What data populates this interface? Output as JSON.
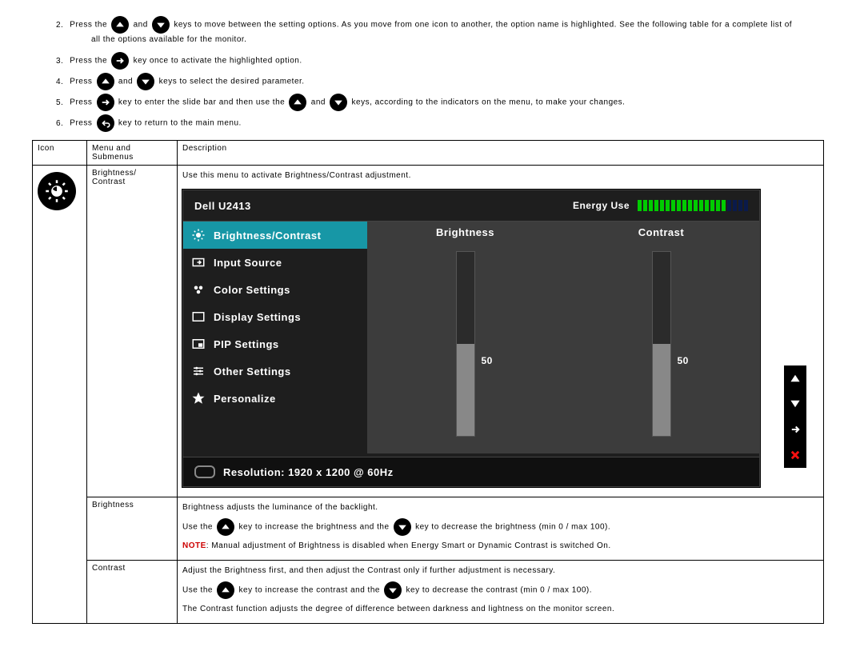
{
  "instructions": {
    "i2a": "Press the",
    "i2b": "and",
    "i2c": "keys to move between the setting options. As you move from one icon to another, the option name is highlighted. See the following table for a complete list of",
    "i2d": "all the options available for the monitor.",
    "i3a": "Press the",
    "i3b": "key once to activate the highlighted option.",
    "i4a": "Press",
    "i4b": "and",
    "i4c": "keys to select the desired parameter.",
    "i5a": "Press",
    "i5b": "key to enter the slide bar and then use the",
    "i5c": "and",
    "i5d": "keys, according to the indicators on the menu, to make your changes.",
    "i6a": "Press",
    "i6b": "key to return to the main menu."
  },
  "table": {
    "head": {
      "icon": "Icon",
      "menu": "Menu and Submenus",
      "desc": "Description"
    },
    "row1": {
      "menu": "Brightness/ Contrast",
      "desc_intro": "Use this menu to activate Brightness/Contrast adjustment."
    },
    "row2": {
      "menu": "Brightness",
      "l1": "Brightness adjusts the luminance of the backlight.",
      "l2a": "Use the",
      "l2b": "key to increase the brightness and the",
      "l2c": "key to decrease the brightness (min 0 / max 100).",
      "l3note": "NOTE",
      "l3rest": ": Manual adjustment of Brightness is disabled when Energy Smart or Dynamic Contrast is switched On."
    },
    "row3": {
      "menu": "Contrast",
      "l1": "Adjust the Brightness first, and then adjust the Contrast only if further adjustment is necessary.",
      "l2a": "Use the",
      "l2b": "key to increase the contrast and the",
      "l2c": "key to decrease the contrast (min 0 / max 100).",
      "l3": "The Contrast function adjusts the degree of difference between darkness and lightness on the monitor screen."
    }
  },
  "osd": {
    "model": "Dell U2413",
    "energy_label": "Energy Use",
    "menu": {
      "brightness_contrast": "Brightness/Contrast",
      "input_source": "Input Source",
      "color_settings": "Color Settings",
      "display_settings": "Display Settings",
      "pip_settings": "PIP Settings",
      "other_settings": "Other Settings",
      "personalize": "Personalize"
    },
    "sliders": {
      "brightness_label": "Brightness",
      "contrast_label": "Contrast",
      "brightness_value": "50",
      "contrast_value": "50"
    },
    "resolution": "Resolution: 1920 x 1200 @ 60Hz"
  }
}
